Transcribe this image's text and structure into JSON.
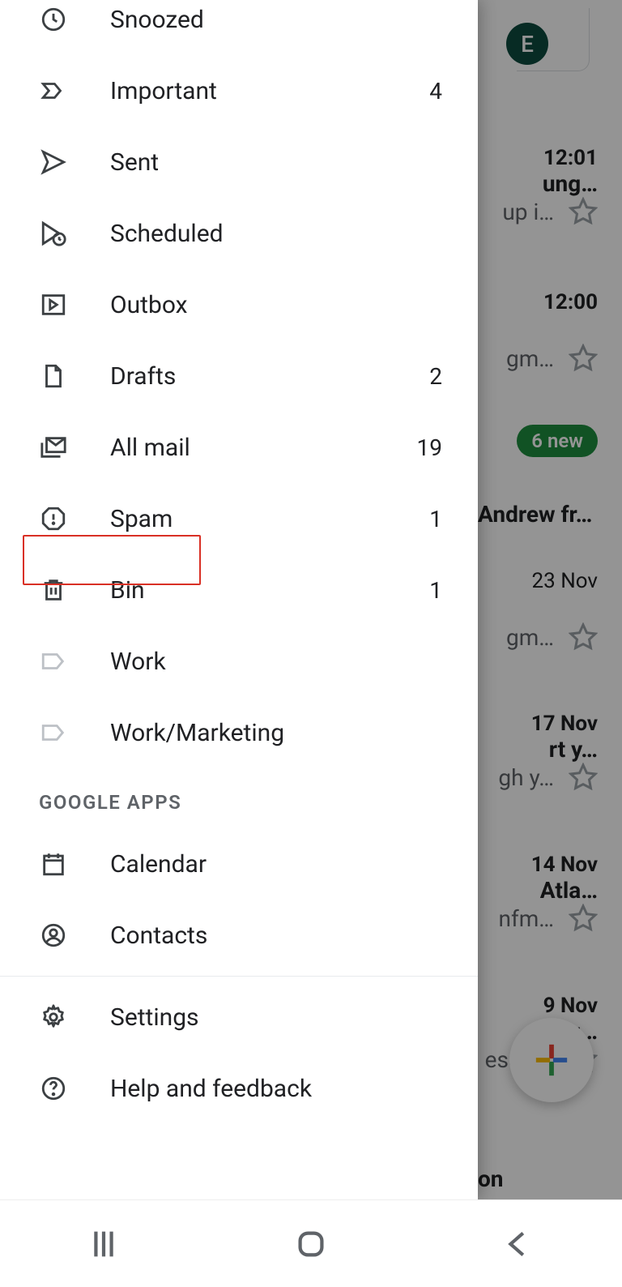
{
  "drawer": {
    "items": [
      {
        "key": "snoozed",
        "label": "Snoozed",
        "count": null
      },
      {
        "key": "important",
        "label": "Important",
        "count": "4"
      },
      {
        "key": "sent",
        "label": "Sent",
        "count": null
      },
      {
        "key": "scheduled",
        "label": "Scheduled",
        "count": null
      },
      {
        "key": "outbox",
        "label": "Outbox",
        "count": null
      },
      {
        "key": "drafts",
        "label": "Drafts",
        "count": "2"
      },
      {
        "key": "allmail",
        "label": "All mail",
        "count": "19"
      },
      {
        "key": "spam",
        "label": "Spam",
        "count": "1"
      },
      {
        "key": "bin",
        "label": "Bin",
        "count": "1"
      },
      {
        "key": "work",
        "label": "Work",
        "count": null
      },
      {
        "key": "workmkt",
        "label": "Work/Marketing",
        "count": null
      }
    ],
    "section_apps": "GOOGLE APPS",
    "apps": [
      {
        "key": "calendar",
        "label": "Calendar"
      },
      {
        "key": "contacts",
        "label": "Contacts"
      }
    ],
    "footer": [
      {
        "key": "settings",
        "label": "Settings"
      },
      {
        "key": "help",
        "label": "Help and feedback"
      }
    ]
  },
  "avatar_initial": "E",
  "inbox": [
    {
      "time": "12:01",
      "l1": "ung…",
      "l2": "up i…"
    },
    {
      "time": "12:00",
      "l1": "",
      "l2": "gm…"
    },
    {
      "badge": "6 new",
      "l1": "Andrew fr…",
      "l2": ""
    },
    {
      "time": "23 Nov",
      "l1": "",
      "l2": "gm…"
    },
    {
      "time": "17 Nov",
      "l1": "rt y…",
      "l2": "gh y…"
    },
    {
      "time": "14 Nov",
      "l1": "Atla…",
      "l2": "nfm…"
    },
    {
      "time": "9 Nov",
      "l1": "ecau…",
      "l2": "ess o…"
    },
    {
      "time": "",
      "l1": "on",
      "l2": ""
    }
  ]
}
